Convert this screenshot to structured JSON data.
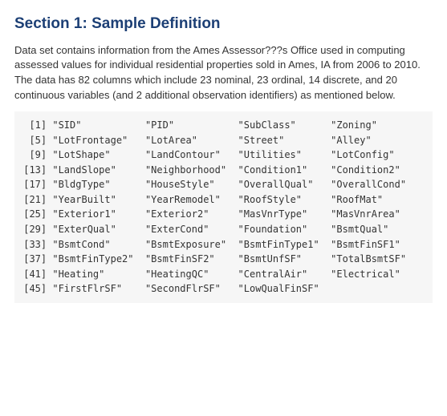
{
  "heading": "Section 1: Sample Definition",
  "intro": "Data set contains information from the Ames Assessor???s Office used in computing assessed values for individual residential properties sold in Ames, IA from 2006 to 2010. The data has 82 columns which include 23 nominal, 23 ordinal, 14 discrete, and 20 continuous variables (and 2 additional observation identifiers) as mentioned below.",
  "chart_data": {
    "type": "table",
    "title": "Column names (quoted strings, indexed)",
    "columns": [
      "SID",
      "PID",
      "SubClass",
      "Zoning",
      "LotFrontage",
      "LotArea",
      "Street",
      "Alley",
      "LotShape",
      "LandContour",
      "Utilities",
      "LotConfig",
      "LandSlope",
      "Neighborhood",
      "Condition1",
      "Condition2",
      "BldgType",
      "HouseStyle",
      "OverallQual",
      "OverallCond",
      "YearBuilt",
      "YearRemodel",
      "RoofStyle",
      "RoofMat",
      "Exterior1",
      "Exterior2",
      "MasVnrType",
      "MasVnrArea",
      "ExterQual",
      "ExterCond",
      "Foundation",
      "BsmtQual",
      "BsmtCond",
      "BsmtExposure",
      "BsmtFinType1",
      "BsmtFinSF1",
      "BsmtFinType2",
      "BsmtFinSF2",
      "BsmtUnfSF",
      "TotalBsmtSF",
      "Heating",
      "HeatingQC",
      "CentralAir",
      "Electrical",
      "FirstFlrSF",
      "SecondFlrSF",
      "LowQualFinSF"
    ]
  },
  "code_text": "  [1] \"SID\"           \"PID\"           \"SubClass\"      \"Zoning\"       \n  [5] \"LotFrontage\"   \"LotArea\"       \"Street\"        \"Alley\"        \n  [9] \"LotShape\"      \"LandContour\"   \"Utilities\"     \"LotConfig\"    \n [13] \"LandSlope\"     \"Neighborhood\"  \"Condition1\"    \"Condition2\"   \n [17] \"BldgType\"      \"HouseStyle\"    \"OverallQual\"   \"OverallCond\"  \n [21] \"YearBuilt\"     \"YearRemodel\"   \"RoofStyle\"     \"RoofMat\"      \n [25] \"Exterior1\"     \"Exterior2\"     \"MasVnrType\"    \"MasVnrArea\"   \n [29] \"ExterQual\"     \"ExterCond\"     \"Foundation\"    \"BsmtQual\"     \n [33] \"BsmtCond\"      \"BsmtExposure\"  \"BsmtFinType1\"  \"BsmtFinSF1\"   \n [37] \"BsmtFinType2\"  \"BsmtFinSF2\"    \"BsmtUnfSF\"     \"TotalBsmtSF\"  \n [41] \"Heating\"       \"HeatingQC\"     \"CentralAir\"    \"Electrical\"   \n [45] \"FirstFlrSF\"    \"SecondFlrSF\"   \"LowQualFinSF\"  "
}
